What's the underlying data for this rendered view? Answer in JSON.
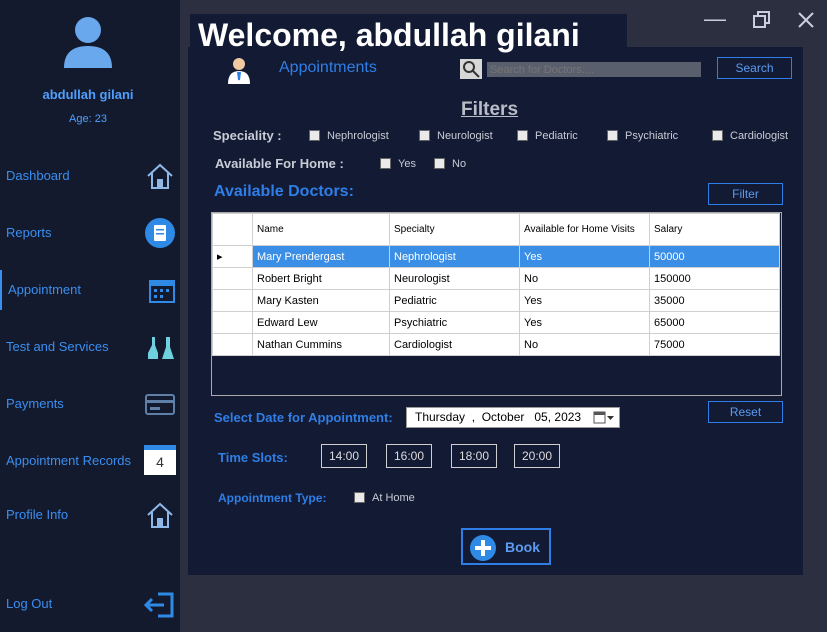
{
  "user": {
    "name": "abdullah gilani",
    "age": "Age: 23"
  },
  "nav": [
    {
      "label": "Dashboard",
      "icon": "home-icon"
    },
    {
      "label": "Reports",
      "icon": "clipboard-icon"
    },
    {
      "label": "Appointment",
      "icon": "calendar-icon"
    },
    {
      "label": "Test and Services",
      "icon": "lab-flask-icon"
    },
    {
      "label": "Payments",
      "icon": "card-icon"
    },
    {
      "label": "Appointment Records",
      "icon": "calendar-4-icon",
      "badge": "4"
    },
    {
      "label": "Profile Info",
      "icon": "home-icon"
    },
    {
      "label": "Log Out",
      "icon": "logout-icon"
    }
  ],
  "header": {
    "welcome": "Welcome, abdullah gilani",
    "page_title": "Appointments"
  },
  "search": {
    "placeholder": "Search for Doctors....",
    "button": "Search"
  },
  "filters": {
    "title": "Filters",
    "speciality_label": "Speciality :",
    "specialities": [
      "Nephrologist",
      "Neurologist",
      "Pediatric",
      "Psychiatric",
      "Cardiologist"
    ],
    "home_label": "Available For Home :",
    "home_options": [
      "Yes",
      "No"
    ],
    "filter_button": "Filter"
  },
  "doctors": {
    "title": "Available Doctors:",
    "columns": [
      "Name",
      "Specialty",
      "Available for Home Visits",
      "Salary"
    ],
    "rows": [
      [
        "Mary Prendergast",
        "Nephrologist",
        "Yes",
        "50000"
      ],
      [
        "Robert Bright",
        "Neurologist",
        "No",
        "150000"
      ],
      [
        "Mary Kasten",
        "Pediatric",
        "Yes",
        "35000"
      ],
      [
        "Edward Lew",
        "Psychiatric",
        "Yes",
        "65000"
      ],
      [
        "Nathan Cummins",
        "Cardiologist",
        "No",
        "75000"
      ]
    ],
    "selected_row": 0
  },
  "date": {
    "label": "Select Date for Appointment:",
    "value": "Thursday  ,  October   05, 2023",
    "reset": "Reset"
  },
  "slots": {
    "label": "Time Slots:",
    "times": [
      "14:00",
      "16:00",
      "18:00",
      "20:00"
    ]
  },
  "type": {
    "label": "Appointment Type:",
    "option": "At Home"
  },
  "book": {
    "label": "Book"
  },
  "colors": {
    "accent": "#2f7ee6",
    "sidebar": "#141a2e",
    "panel": "#131a33"
  }
}
